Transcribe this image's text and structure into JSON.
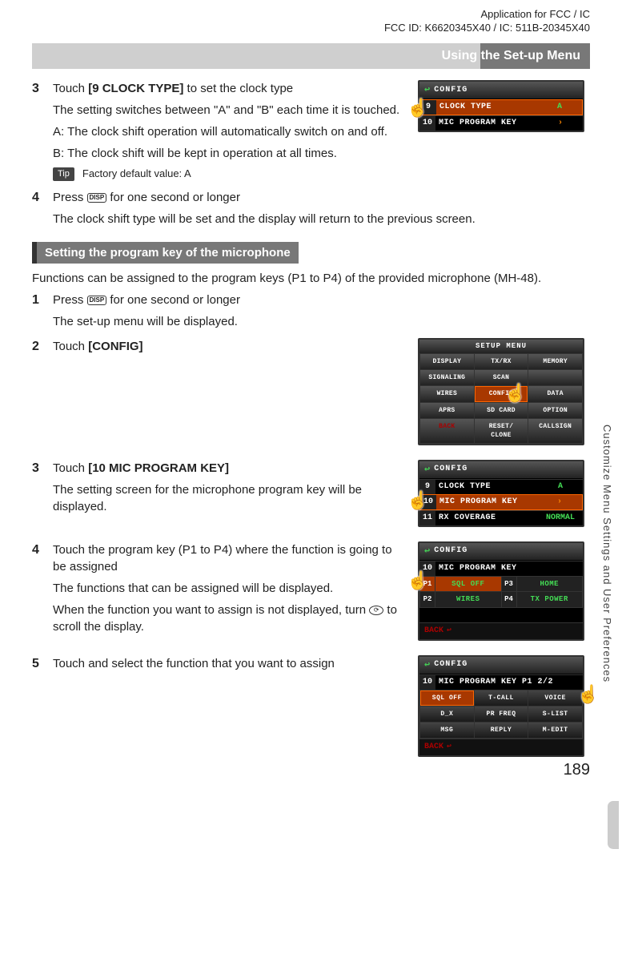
{
  "header": {
    "line1": "Application for FCC / IC",
    "line2": "FCC ID: K6620345X40 / IC: 511B-20345X40"
  },
  "section_bar": "Using the Set-up Menu",
  "step3": {
    "num": "3",
    "line1a": "Touch ",
    "line1b": "[9 CLOCK TYPE]",
    "line1c": " to set the clock type",
    "line2": "The setting switches between \"A\" and \"B\" each time it is touched.",
    "lineA": "A: The clock shift operation will automatically switch on and off.",
    "lineB": "B: The clock shift will be kept in operation at all times.",
    "tip_label": "Tip",
    "tip_text": "Factory default value: A"
  },
  "screenA": {
    "title": "CONFIG",
    "row1_num": "9",
    "row1_label": "CLOCK TYPE",
    "row1_val": "A",
    "row2_num": "10",
    "row2_label": "MIC PROGRAM KEY",
    "row2_val": "›"
  },
  "step4": {
    "num": "4",
    "line1a": "Press ",
    "disp": "DISP",
    "line1b": " for one second or longer",
    "line2": "The clock shift type will be set and the display will return to the previous screen."
  },
  "subheading": "Setting the program key of the microphone",
  "intro": "Functions can be assigned to the program keys (P1 to P4) of the provided microphone (MH-48).",
  "step1": {
    "num": "1",
    "line1a": "Press ",
    "line1b": " for one second or longer",
    "line2": "The set-up menu will be displayed."
  },
  "step2": {
    "num": "2",
    "line1a": "Touch ",
    "line1b": "[CONFIG]"
  },
  "screenSetup": {
    "title": "SETUP MENU",
    "cells": [
      "DISPLAY",
      "TX/RX",
      "MEMORY",
      "SIGNALING",
      "SCAN",
      "",
      "WIRES",
      "CONFIG",
      "DATA",
      "APRS",
      "SD CARD",
      "OPTION",
      "BACK",
      "RESET/\nCLONE",
      "CALLSIGN"
    ]
  },
  "step3b": {
    "num": "3",
    "line1a": "Touch ",
    "line1b": "[10 MIC PROGRAM KEY]",
    "line2": "The setting screen for the microphone program key will be displayed."
  },
  "screenB": {
    "title": "CONFIG",
    "r1n": "9",
    "r1l": "CLOCK TYPE",
    "r1v": "A",
    "r2n": "10",
    "r2l": "MIC PROGRAM KEY",
    "r2v": "›",
    "r3n": "11",
    "r3l": "RX COVERAGE",
    "r3v": "NORMAL"
  },
  "step4b": {
    "num": "4",
    "line1": "Touch the program key (P1 to P4) where the function is going to be assigned",
    "line2": "The functions that can be assigned will be displayed.",
    "line3a": "When the function you want to assign is not displayed, turn ",
    "line3b": " to scroll the display."
  },
  "screenC": {
    "title": "CONFIG",
    "hdr_num": "10",
    "hdr_label": "MIC PROGRAM KEY",
    "p1": "P1",
    "p1v": "SQL OFF",
    "p2": "P2",
    "p2v": "WIRES",
    "p3": "P3",
    "p3v": "HOME",
    "p4": "P4",
    "p4v": "TX POWER",
    "back": "BACK"
  },
  "step5": {
    "num": "5",
    "line1": "Touch and select the function that you want to assign"
  },
  "screenD": {
    "title": "CONFIG",
    "hdr_num": "10",
    "hdr_label": "MIC PROGRAM KEY P1 2/2",
    "cells": [
      "SQL OFF",
      "T-CALL",
      "VOICE",
      "D_X",
      "PR FREQ",
      "S-LIST",
      "MSG",
      "REPLY",
      "M-EDIT"
    ],
    "back": "BACK"
  },
  "sidetext": "Customize Menu Settings and User Preferences",
  "page_num": "189"
}
